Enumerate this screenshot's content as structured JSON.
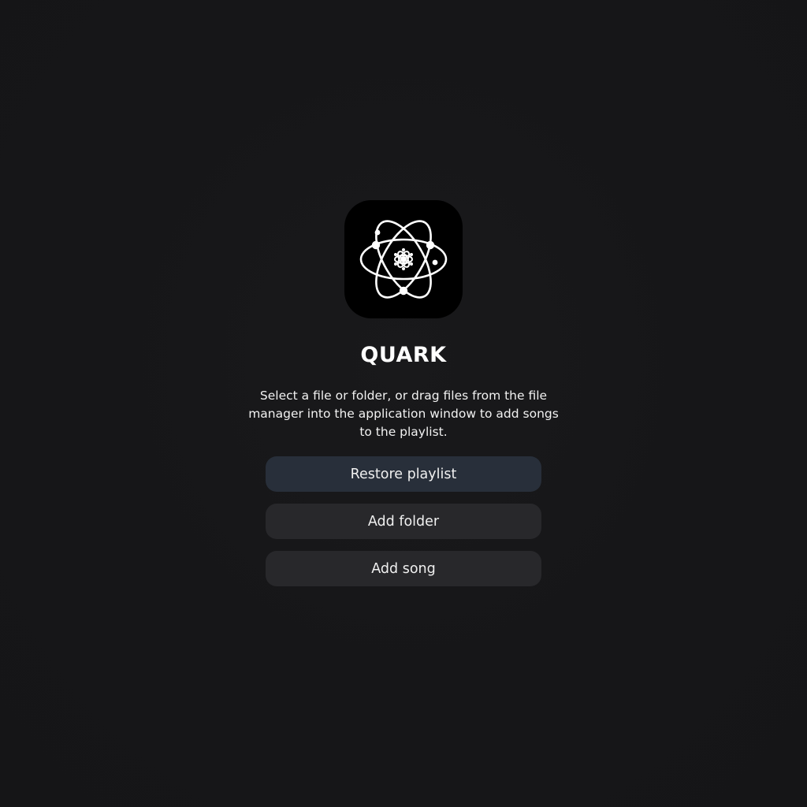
{
  "app": {
    "title": "QUARK",
    "logo_icon": "atom-icon",
    "logo_background": "#000000"
  },
  "welcome": {
    "description": "Select a file or folder, or drag files from the file manager into the application window to add songs to the playlist."
  },
  "actions": {
    "restore_playlist_label": "Restore playlist",
    "add_folder_label": "Add folder",
    "add_song_label": "Add song"
  },
  "colors": {
    "background": "#161618",
    "primary_button": "#282f3a",
    "secondary_button": "#28282b",
    "text": "#ffffff"
  }
}
